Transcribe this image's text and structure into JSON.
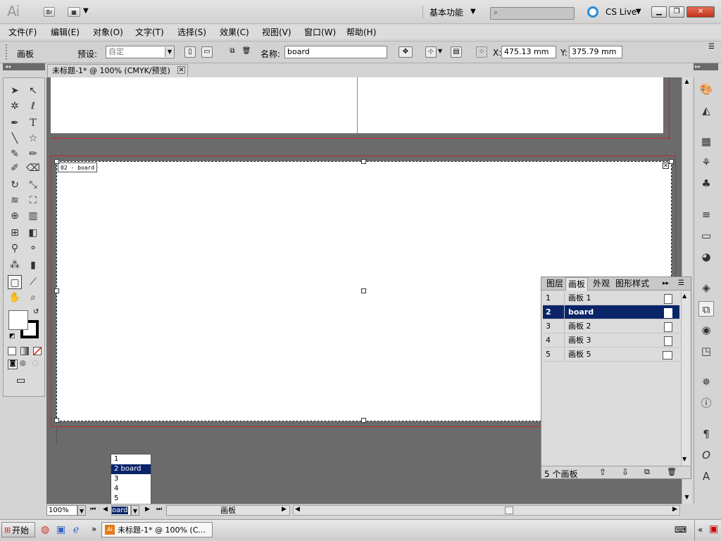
{
  "titlebar": {
    "app_logo": "Ai",
    "bridge_label": "Br",
    "workspace_label": "基本功能",
    "cslive_label": "CS Live"
  },
  "menu": [
    "文件(F)",
    "编辑(E)",
    "对象(O)",
    "文字(T)",
    "选择(S)",
    "效果(C)",
    "视图(V)",
    "窗口(W)",
    "帮助(H)"
  ],
  "controlbar": {
    "mode_label": "画板",
    "preset_label": "预设:",
    "preset_value": "自定",
    "name_label": "名称:",
    "name_value": "board",
    "x_label": "X:",
    "x_value": "475.13 mm",
    "y_label": "Y:",
    "y_value": "375.79 mm"
  },
  "document": {
    "tab_title": "未标题-1* @ 100% (CMYK/预览)",
    "artboard_label": "02 - board"
  },
  "artboards_panel": {
    "tabs": [
      "图层",
      "画板",
      "外观",
      "图形样式"
    ],
    "active_tab": "画板",
    "rows": [
      {
        "num": "1",
        "name": "画板 1"
      },
      {
        "num": "2",
        "name": "board"
      },
      {
        "num": "3",
        "name": "画板 2"
      },
      {
        "num": "4",
        "name": "画板 3"
      },
      {
        "num": "5",
        "name": "画板 5"
      }
    ],
    "footer_count": "5 个画板"
  },
  "statusbar": {
    "zoom": "100%",
    "artboard_selector": "oard",
    "status_label": "画板"
  },
  "artboard_dropdown": [
    "1",
    "2 board",
    "3",
    "4",
    "5"
  ],
  "taskbar": {
    "start_label": "开始",
    "window_label": "未标题-1* @ 100% (C..."
  },
  "colors": {
    "selection_blue": "#0a246a",
    "artboard_border": "#c0282b",
    "canvas_gray": "#6b6b6b"
  }
}
